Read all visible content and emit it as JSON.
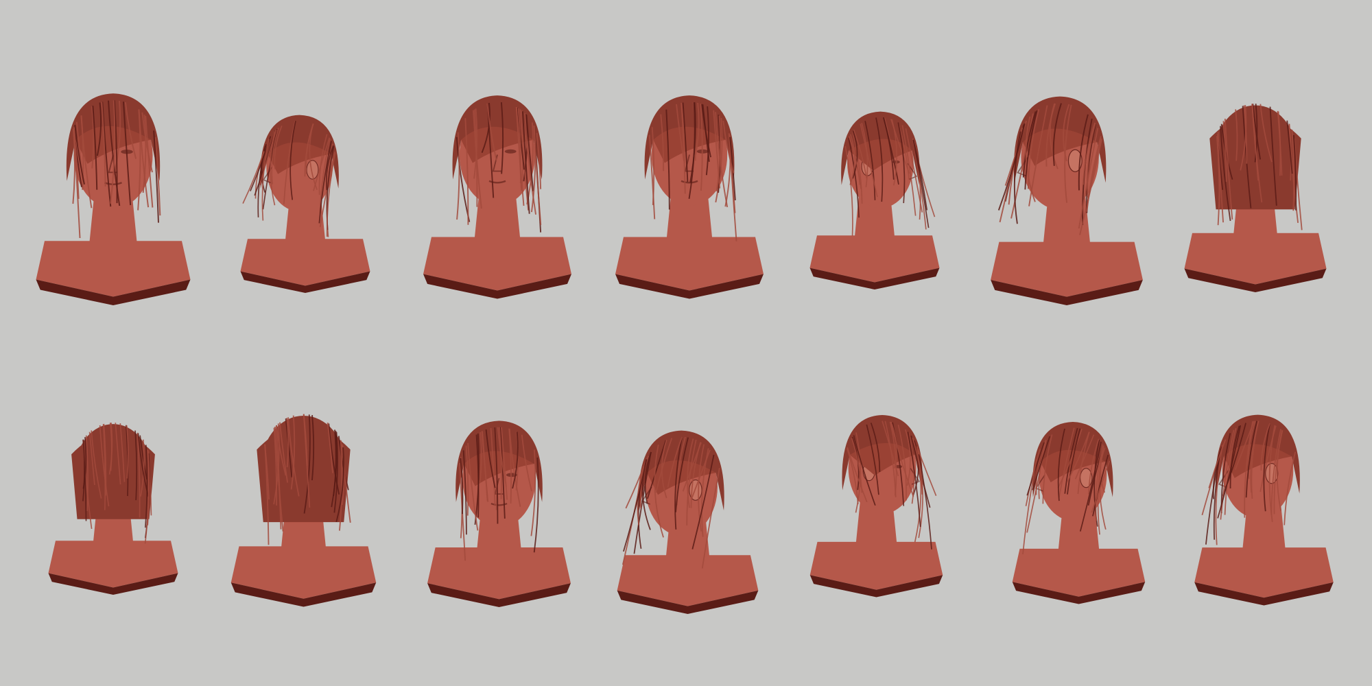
{
  "title": "",
  "colors": {
    "background": "#c8c8c6",
    "skin": "#b5584a",
    "skin_light": "#c97a68",
    "hair": "#8a3a2e",
    "shadow": "#5a1c16"
  },
  "busts": [
    {
      "name": "bust-front-1",
      "view": "front"
    },
    {
      "name": "bust-left-back-quarter-1",
      "view": "left-back-quarter"
    },
    {
      "name": "bust-front-2",
      "view": "front"
    },
    {
      "name": "bust-front-3",
      "view": "front"
    },
    {
      "name": "bust-right-profile-1",
      "view": "right-profile"
    },
    {
      "name": "bust-left-three-quarter-1",
      "view": "left-three-quarter"
    },
    {
      "name": "bust-back-right-1",
      "view": "back-right"
    },
    {
      "name": "bust-back-right-2",
      "view": "back-right"
    },
    {
      "name": "bust-back-1",
      "view": "back"
    },
    {
      "name": "bust-front-down-1",
      "view": "front-down"
    },
    {
      "name": "bust-left-down-1",
      "view": "left-down"
    },
    {
      "name": "bust-right-profile-2",
      "view": "right-profile"
    },
    {
      "name": "bust-left-profile-1",
      "view": "left-profile"
    },
    {
      "name": "bust-left-profile-2",
      "view": "left-profile"
    }
  ]
}
